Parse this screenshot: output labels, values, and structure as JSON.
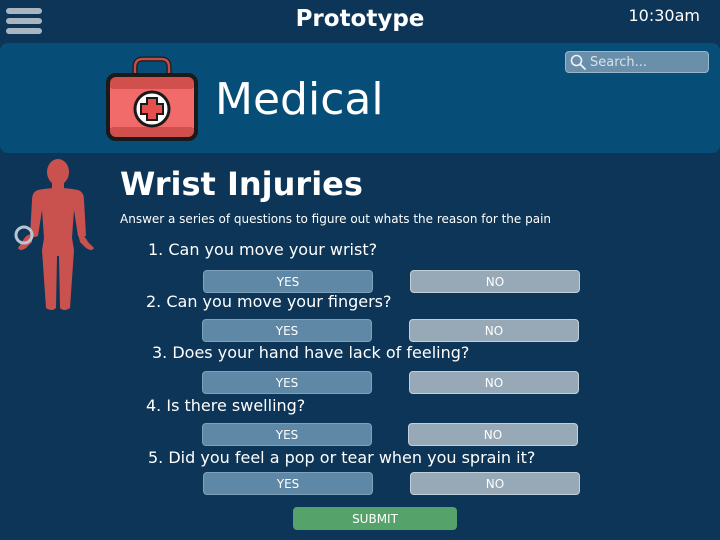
{
  "topbar": {
    "title": "Prototype",
    "time": "10:30am",
    "menu_icon": "hamburger-menu-icon"
  },
  "search": {
    "placeholder": "Search...",
    "icon": "search-icon"
  },
  "category": {
    "title": "Medical",
    "icon": "first-aid-kit-icon"
  },
  "page": {
    "title": "Wrist Injuries",
    "subtitle": "Answer a series of questions to figure out whats the reason for the pain",
    "figure_icon": "human-body-icon"
  },
  "questions": [
    {
      "text": "1. Can you move your wrist?",
      "yes": "YES",
      "no": "NO"
    },
    {
      "text": "2. Can you move your fingers?",
      "yes": "YES",
      "no": "NO"
    },
    {
      "text": "3. Does your hand have lack of feeling?",
      "yes": "YES",
      "no": "NO"
    },
    {
      "text": "4. Is there swelling?",
      "yes": "YES",
      "no": "NO"
    },
    {
      "text": "5. Did you feel a pop or tear when you sprain it?",
      "yes": "YES",
      "no": "NO"
    }
  ],
  "submit_label": "SUBMIT",
  "colors": {
    "background": "#0d3557",
    "header_band": "#064e77",
    "yes_button": "#5e88a6",
    "no_button": "#97a9b6",
    "submit_button": "#55a36a",
    "accent_red": "#c9524f"
  }
}
